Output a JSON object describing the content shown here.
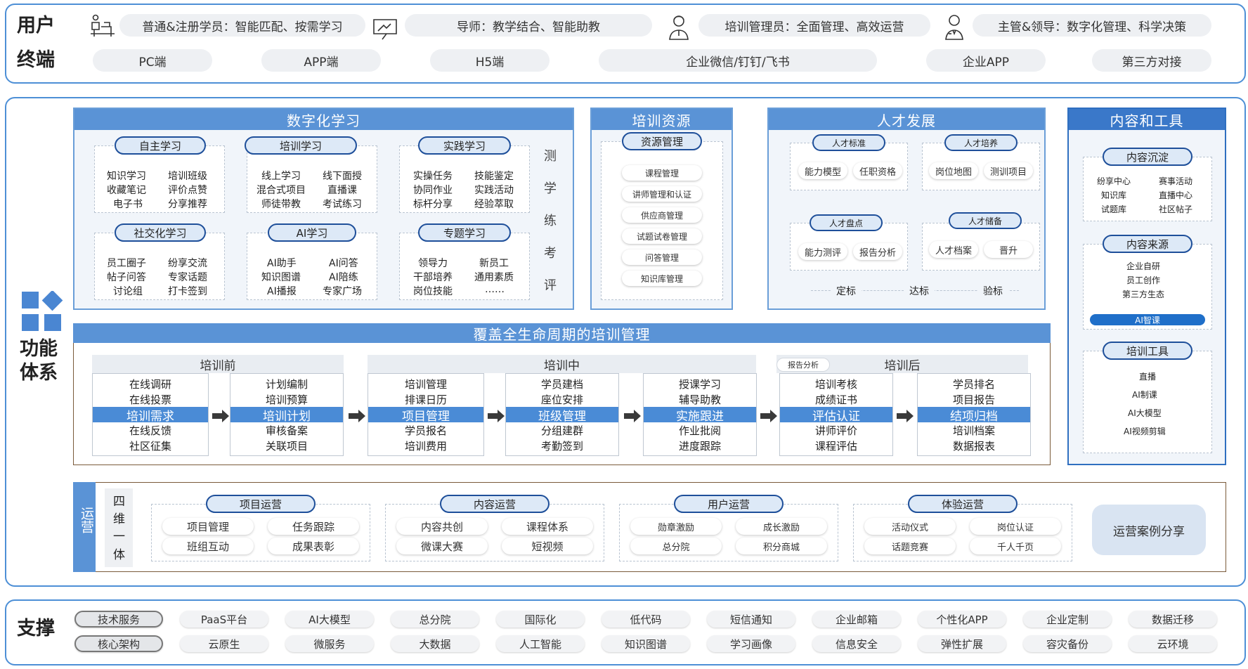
{
  "users": {
    "label_line1": "用户",
    "label_line2": "终端",
    "roles": [
      {
        "icon": "student-desk-icon",
        "text": "普通&注册学员：智能匹配、按需学习"
      },
      {
        "icon": "teacher-board-icon",
        "text": "导师：教学结合、智能助教"
      },
      {
        "icon": "manager-person-icon",
        "text": "培训管理员：全面管理、高效运营"
      },
      {
        "icon": "leader-person-icon",
        "text": "主管&领导：数字化管理、科学决策"
      }
    ],
    "terminals": [
      "PC端",
      "APP端",
      "H5端",
      "企业微信/钉钉/飞书",
      "企业APP",
      "第三方对接"
    ]
  },
  "func": {
    "label_line1": "功能",
    "label_line2": "体系",
    "digital": {
      "title": "数字化学习",
      "side": [
        "测",
        "学",
        "练",
        "考",
        "评"
      ],
      "groups": [
        {
          "tag": "自主学习",
          "items": [
            "知识学习",
            "培训班级",
            "收藏笔记",
            "评价点赞",
            "电子书",
            "分享推荐"
          ]
        },
        {
          "tag": "培训学习",
          "items": [
            "线上学习",
            "线下面授",
            "混合式项目",
            "直播课",
            "师徒带教",
            "考试练习"
          ]
        },
        {
          "tag": "实践学习",
          "items": [
            "实操任务",
            "技能鉴定",
            "协同作业",
            "实践活动",
            "标杆分享",
            "经验萃取"
          ]
        },
        {
          "tag": "社交化学习",
          "items": [
            "员工圈子",
            "纷享交流",
            "帖子问答",
            "专家话题",
            "讨论组",
            "打卡签到"
          ]
        },
        {
          "tag": "AI学习",
          "items": [
            "AI助手",
            "AI问答",
            "知识图谱",
            "AI陪练",
            "AI播报",
            "专家广场"
          ]
        },
        {
          "tag": "专题学习",
          "items": [
            "领导力",
            "新员工",
            "干部培养",
            "通用素质",
            "岗位技能",
            "……"
          ]
        }
      ]
    },
    "resources": {
      "title": "培训资源",
      "tag": "资源管理",
      "items": [
        "课程管理",
        "讲师管理和认证",
        "供应商管理",
        "试题试卷管理",
        "问答管理",
        "知识库管理"
      ]
    },
    "talent": {
      "title": "人才发展",
      "groups": [
        {
          "tag": "人才标准",
          "items": [
            "能力模型",
            "任职资格"
          ]
        },
        {
          "tag": "人才培养",
          "items": [
            "岗位地图",
            "测训项目"
          ]
        },
        {
          "tag": "人才盘点",
          "items": [
            "能力测评",
            "报告分析"
          ]
        },
        {
          "tag": "人才储备",
          "items": [
            "人才档案",
            "晋升"
          ]
        }
      ],
      "steps": [
        "定标",
        "达标",
        "验标"
      ]
    },
    "content": {
      "title": "内容和工具",
      "g1_tag": "内容沉淀",
      "g1_items": [
        "纷享中心",
        "赛事活动",
        "知识库",
        "直播中心",
        "试题库",
        "社区帖子"
      ],
      "g2_tag": "内容来源",
      "g2_items": [
        "企业自研",
        "员工创作",
        "第三方生态"
      ],
      "g2_bar": "AI智课",
      "g3_tag": "培训工具",
      "g3_items": [
        "直播",
        "AI制课",
        "AI大模型",
        "AI视频剪辑"
      ]
    },
    "lifecycle": {
      "title": "覆盖全生命周期的培训管理",
      "phases": [
        "培训前",
        "培训中",
        "培训后"
      ],
      "report_tag": "报告分析",
      "columns": [
        {
          "rows": [
            "在线调研",
            "在线投票",
            "培训需求",
            "在线反馈",
            "社区征集"
          ]
        },
        {
          "rows": [
            "计划编制",
            "培训预算",
            "培训计划",
            "审核备案",
            "关联项目"
          ]
        },
        {
          "rows": [
            "培训管理",
            "排课日历",
            "项目管理",
            "学员报名",
            "培训费用"
          ]
        },
        {
          "rows": [
            "学员建档",
            "座位安排",
            "班级管理",
            "分组建群",
            "考勤签到"
          ]
        },
        {
          "rows": [
            "授课学习",
            "辅导助教",
            "实施跟进",
            "作业批阅",
            "进度跟踪"
          ]
        },
        {
          "rows": [
            "培训考核",
            "成绩证书",
            "评估认证",
            "讲师评价",
            "课程评估"
          ]
        },
        {
          "rows": [
            "学员排名",
            "项目报告",
            "结项归档",
            "培训档案",
            "数据报表"
          ]
        }
      ]
    },
    "ops": {
      "label": "运营",
      "side": [
        "四",
        "维",
        "一",
        "体"
      ],
      "groups": [
        {
          "tag": "项目运营",
          "items": [
            "项目管理",
            "任务跟踪",
            "班组互动",
            "成果表彰"
          ]
        },
        {
          "tag": "内容运营",
          "items": [
            "内容共创",
            "课程体系",
            "微课大赛",
            "短视频"
          ]
        },
        {
          "tag": "用户运营",
          "items": [
            "勋章激励",
            "成长激励",
            "总分院",
            "积分商城"
          ]
        },
        {
          "tag": "体验运营",
          "items": [
            "活动仪式",
            "岗位认证",
            "话题竞赛",
            "千人千页"
          ]
        }
      ],
      "case_button": "运营案例分享"
    }
  },
  "support": {
    "label": "支撑",
    "row1": [
      "技术服务",
      "PaaS平台",
      "AI大模型",
      "总分院",
      "国际化",
      "低代码",
      "短信通知",
      "企业邮箱",
      "个性化APP",
      "企业定制",
      "数据迁移"
    ],
    "row2": [
      "核心架构",
      "云原生",
      "微服务",
      "大数据",
      "人工智能",
      "知识图谱",
      "学习画像",
      "信息安全",
      "弹性扩展",
      "容灾备份",
      "云环境"
    ]
  }
}
